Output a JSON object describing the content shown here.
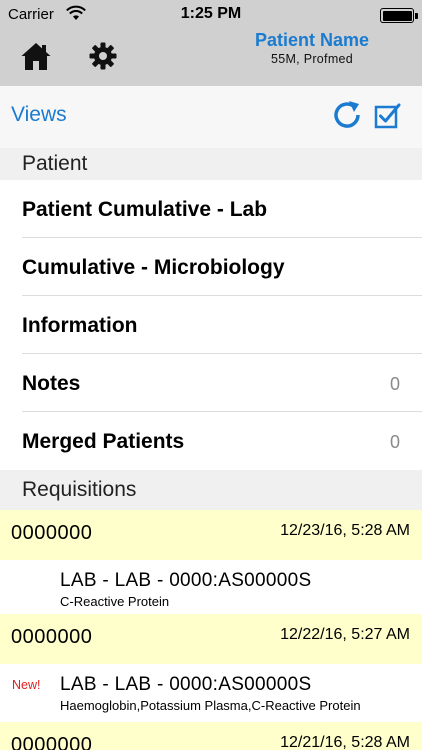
{
  "status_bar": {
    "carrier": "Carrier",
    "time": "1:25 PM"
  },
  "header": {
    "home_icon": "home-icon",
    "settings_icon": "gear-icon",
    "patient_name": "Patient Name",
    "patient_meta": "55M, Profmed"
  },
  "views_bar": {
    "label": "Views",
    "refresh_icon": "refresh-icon",
    "check_icon": "checkbox-icon"
  },
  "patient_section": {
    "header": "Patient",
    "items": [
      {
        "label": "Patient Cumulative - Lab",
        "count": ""
      },
      {
        "label": "Cumulative - Microbiology",
        "count": ""
      },
      {
        "label": "Information",
        "count": ""
      },
      {
        "label": "Notes",
        "count": "0"
      },
      {
        "label": "Merged Patients",
        "count": "0"
      }
    ]
  },
  "requisitions_section": {
    "header": "Requisitions",
    "items": [
      {
        "id": "0000000",
        "date": "12/23/16, 5:28 AM",
        "badge": "",
        "title": "LAB - LAB - 0000:AS00000S",
        "tests": "C-Reactive Protein"
      },
      {
        "id": "0000000",
        "date": "12/22/16, 5:27 AM",
        "badge": "New!",
        "title": "LAB - LAB - 0000:AS00000S",
        "tests": "Haemoglobin,Potassium Plasma,C-Reactive Protein"
      },
      {
        "id": "0000000",
        "date": "12/21/16, 5:28 AM",
        "badge": "",
        "title": "",
        "tests": ""
      }
    ]
  },
  "colors": {
    "accent": "#1a7bd0",
    "header_bg": "#d0d0d0",
    "requisition_bg": "#ffffcc",
    "new_badge": "#e02020"
  }
}
